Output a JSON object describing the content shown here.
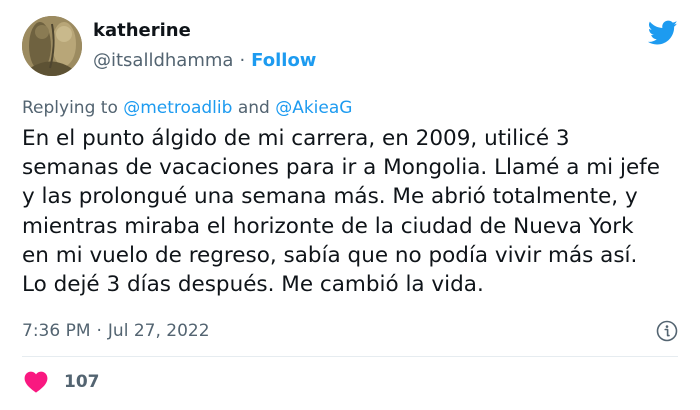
{
  "author": {
    "display_name": "katherine",
    "handle": "@itsalldhamma",
    "separator": "·",
    "follow_label": "Follow"
  },
  "reply": {
    "prefix": "Replying to",
    "mention_1": "@metroadlib",
    "conjunction": "and",
    "mention_2": "@AkieaG"
  },
  "tweet_text": {
    "lines": [
      "En el punto álgido de mi carrera, en 2009, utilicé 3",
      "semanas de vacaciones para ir a Mongolia. Llamé a mi jefe",
      "y las prolongué una semana más. Me abrió totalmente, y",
      "mientras miraba el horizonte de la ciudad de Nueva York",
      "en mi vuelo de regreso, sabía que no podía vivir más así.",
      "Lo dejé 3 días después. Me cambió la vida."
    ]
  },
  "meta": {
    "time": "7:36 PM",
    "separator": "·",
    "date": "Jul 27, 2022"
  },
  "engagement": {
    "like_count": "107"
  },
  "icons": {
    "brand": "twitter-bird-icon",
    "info": "info-icon",
    "like": "heart-icon"
  },
  "colors": {
    "accent": "#1d9bf0",
    "like": "#f91880",
    "secondary_text": "#536471",
    "primary_text": "#0f1419"
  }
}
